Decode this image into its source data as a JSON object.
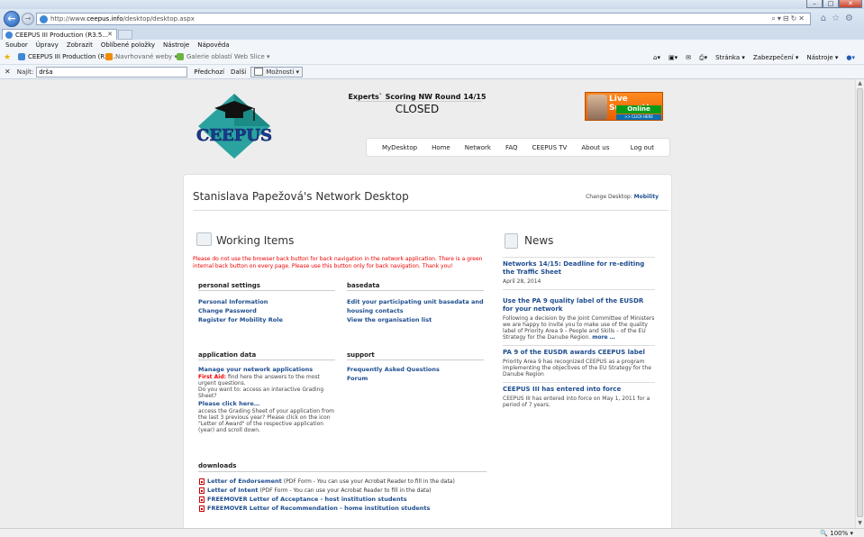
{
  "browser": {
    "url_prefix": "http://www.",
    "url_domain": "ceepus.info",
    "url_path": "/desktop/desktop.aspx",
    "tab_title": "CEEPUS III Production (R3.5...",
    "menu": [
      "Soubor",
      "Úpravy",
      "Zobrazit",
      "Oblíbené položky",
      "Nástroje",
      "Nápověda"
    ],
    "favorites": [
      "CEEPUS III Production (R3)...",
      "Navrhované weby ▾",
      "Galerie oblastí Web Slice ▾"
    ],
    "commands": [
      "Stránka ▾",
      "Zabezpečení ▾",
      "Nástroje ▾"
    ],
    "find_label": "Najít:",
    "find_value": "drša",
    "find_prev": "Předchozí",
    "find_next": "Další",
    "find_options": "Možnosti ▾",
    "zoom": "100%"
  },
  "header": {
    "round_title": "Experts` Scoring NW Round 14/15",
    "round_status": "CLOSED",
    "logo_text": "CEEPUS",
    "live": {
      "line1": "Live Support!",
      "line2": "Online",
      "line3": ">> CLICK HERE"
    },
    "nav": [
      "MyDesktop",
      "Home",
      "Network",
      "FAQ",
      "CEEPUS TV",
      "About us"
    ],
    "logout": "Log out"
  },
  "desktop": {
    "title": "Stanislava Papežová's Network Desktop",
    "change_label": "Change Desktop:",
    "change_value": "Mobility"
  },
  "working": {
    "title": "Working Items",
    "warning": "Please do not use the browser back button for back navigation in the network application. There is a green internal back button on every page. Please use this button only for back navigation. Thank you!",
    "personal": {
      "head": "personal settings",
      "links": [
        "Personal Information",
        "Change Password",
        "Register for Mobility Role"
      ]
    },
    "basedata": {
      "head": "basedata",
      "links": [
        "Edit your participating unit basedata and housing contacts",
        "View the organisation list"
      ]
    },
    "application": {
      "head": "application data",
      "link": "Manage your network applications",
      "first_aid_label": "First Aid:",
      "first_aid_text": "find here the answers to the most urgent questions.",
      "question": "Do you want to: access an interactive Grading Sheet?",
      "click": "Please click here…",
      "access": "access the Grading Sheet of your application from the last 3 previous year? Please click on the icon \"Letter of Award\" of the respective application (year) and scroll down."
    },
    "support": {
      "head": "support",
      "links": [
        "Frequently Asked Questions",
        "Forum"
      ]
    },
    "downloads": {
      "head": "downloads",
      "items": [
        {
          "link": "Letter of Endorsement",
          "note": "(PDF Form - You can use your Acrobat Reader to fill in the data)"
        },
        {
          "link": "Letter of Intent",
          "note": "(PDF Form - You can use your Acrobat Reader to fill in the data)"
        },
        {
          "link": "FREEMOVER Letter of Acceptance - host institution students",
          "note": ""
        },
        {
          "link": "FREEMOVER Letter of Recommendation - home institution students",
          "note": ""
        }
      ]
    }
  },
  "news": {
    "title": "News",
    "items": [
      {
        "title": "Networks 14/15: Deadline for re-editing the Traffic Sheet",
        "body": "April 28, 2014",
        "more": ""
      },
      {
        "title": "Use the PA 9 quality label of the EUSDR for your network",
        "body": "Following a decision by the Joint Committee of Ministers we are happy to invite you to make use of the quality label of Priority Area 9 – People and Skills – of the EU Strategy for the Danube Region.",
        "more": "more …"
      },
      {
        "title": "PA 9 of the EUSDR awards CEEPUS label",
        "body": "Priority Area 9 has recognized CEEPUS as a program implementing the objectives of the EU Strategy for the Danube Region",
        "more": ""
      },
      {
        "title": "CEEPUS III has entered into force",
        "body": "CEEPUS III has entered into force on May 1, 2011 for a period of 7 years.",
        "more": ""
      }
    ]
  }
}
